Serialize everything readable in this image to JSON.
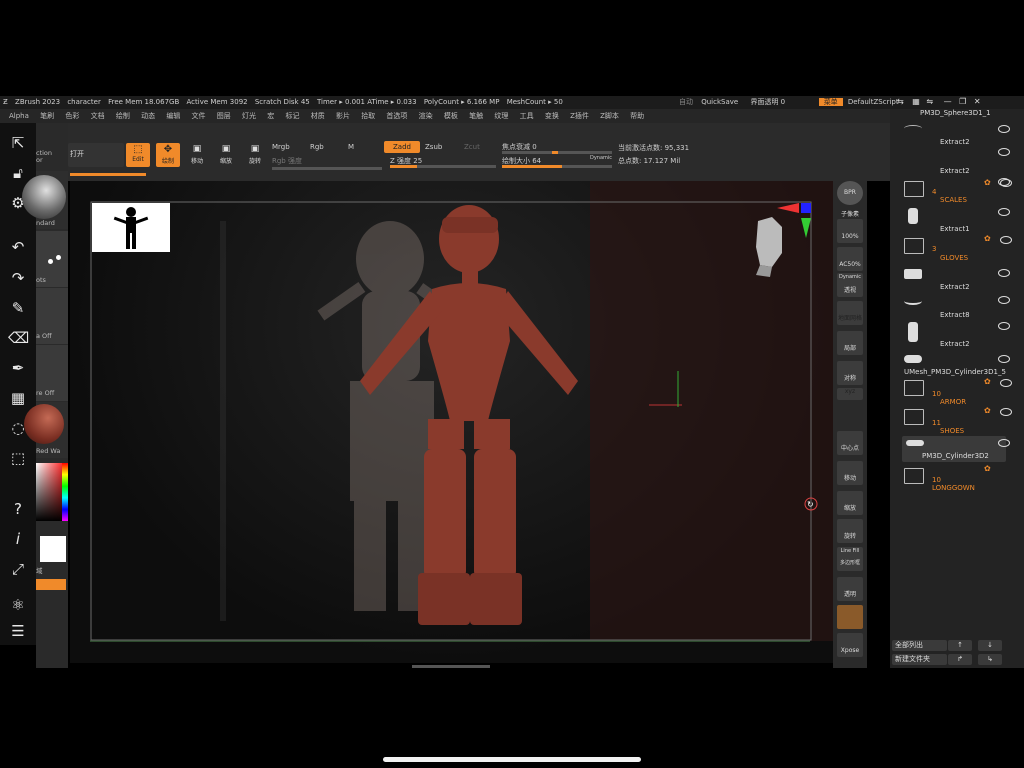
{
  "titlebar": {
    "app": "ZBrush 2023",
    "doc": "character",
    "free_mem": "Free Mem 18.067GB",
    "active_mem": "Active Mem 3092",
    "scratch": "Scratch Disk 45",
    "timer": "Timer ▸ 0.001 ATime ▸ 0.033",
    "polycount": "PolyCount ▸ 6.166 MP",
    "meshcount": "MeshCount ▸ 50",
    "auto_label": "自动",
    "quicksave": "QuickSave",
    "transparency_label": "界面透明 0",
    "menu_label": "菜单",
    "script_label": "DefaultZScript"
  },
  "menubar": {
    "items": [
      "Alpha",
      "笔刷",
      "色彩",
      "文档",
      "绘制",
      "动态",
      "编辑",
      "文件",
      "图层",
      "灯光",
      "宏",
      "标记",
      "材质",
      "影片",
      "拾取",
      "首选项",
      "渲染",
      "模板",
      "笔触",
      "纹理",
      "工具",
      "变换",
      "Z插件",
      "Z脚本",
      "帮助"
    ]
  },
  "shelf": {
    "open_label": "打开",
    "edit_label": "Edit",
    "draw_label": "绘制",
    "move_label": "移动",
    "scale_label": "缩放",
    "rotate_label": "旋转",
    "mrgb": "Mrgb",
    "rgb": "Rgb",
    "m": "M",
    "rgb_strength": "Rgb 强度",
    "zadd": "Zadd",
    "zsub": "Zsub",
    "zcut": "Zcut",
    "z_strength": "Z 强度 25",
    "focal_shift": "焦点衰减 0",
    "draw_size": "绘制大小 64",
    "dynamic": "Dynamic",
    "active_points": "当前激活点数: 95,331",
    "total_points": "总点数: 17.127 Mil",
    "z_strength_value": 25,
    "draw_size_value": 64
  },
  "leftpalette": {
    "brush": "ction",
    "brush2": "or",
    "material": "ndard",
    "stroke": "ots",
    "alpha": "a Off",
    "texture": "re Off",
    "matcap": "Red Wa",
    "extra": "域"
  },
  "rightbar": {
    "items": [
      {
        "label": "BPR"
      },
      {
        "label": "子像素"
      },
      {
        "label": "100%"
      },
      {
        "label": "AC50%"
      },
      {
        "label": "Dynamic"
      },
      {
        "label": "透视"
      },
      {
        "label": "地面网格"
      },
      {
        "label": "局部"
      },
      {
        "label": "对称"
      },
      {
        "label": "xyz"
      },
      {
        "label": "中心点"
      },
      {
        "label": "移动"
      },
      {
        "label": "缩放"
      },
      {
        "label": "旋转"
      },
      {
        "label": "Line Fill"
      },
      {
        "label": "多边形框"
      },
      {
        "label": "透明"
      },
      {
        "label": "Xpose"
      }
    ]
  },
  "subtool": {
    "rows": [
      {
        "type": "item",
        "name": "PM3D_Sphere3D1_1"
      },
      {
        "type": "item",
        "name": "Extract2"
      },
      {
        "type": "item",
        "name": "Extract2"
      },
      {
        "type": "folder",
        "name": "SCALES",
        "count": "4"
      },
      {
        "type": "item",
        "name": "Extract1"
      },
      {
        "type": "folder",
        "name": "GLOVES",
        "count": "3"
      },
      {
        "type": "item",
        "name": "Extract2"
      },
      {
        "type": "item",
        "name": "Extract8"
      },
      {
        "type": "item",
        "name": "Extract2"
      },
      {
        "type": "item",
        "name": "UMesh_PM3D_Cylinder3D1_5"
      },
      {
        "type": "folder",
        "name": "ARMOR",
        "count": "10"
      },
      {
        "type": "folder",
        "name": "SHOES",
        "count": "11"
      },
      {
        "type": "item",
        "name": "PM3D_Cylinder3D2"
      },
      {
        "type": "folder",
        "name": "LONGGOWN",
        "count": "10"
      }
    ],
    "list_all": "全部列出",
    "new_folder": "新建文件夹"
  },
  "colors": {
    "accent": "#f08a2a",
    "model": "#8a3a2c"
  }
}
